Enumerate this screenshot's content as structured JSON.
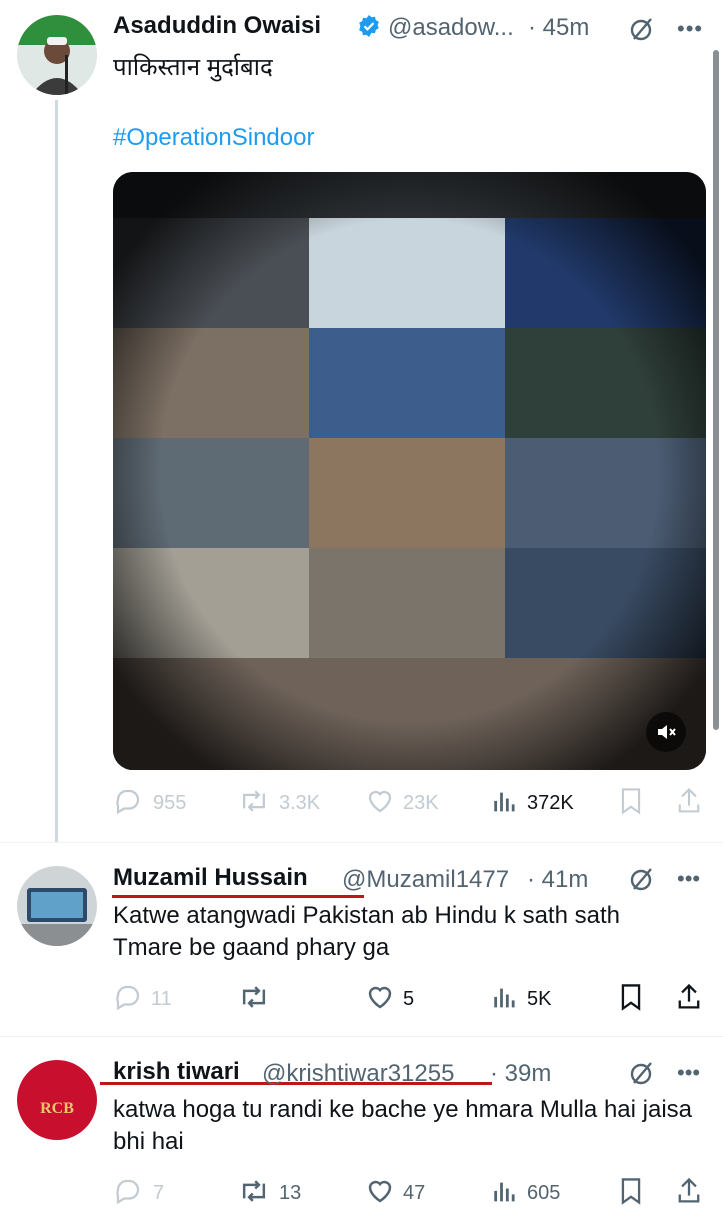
{
  "tweet1": {
    "name": "Asaduddin Owaisi",
    "handle": "@asadow...",
    "time": "· 45m",
    "text": "पाकिस्तान मुर्दाबाद",
    "hashtag": "#OperationSindoor",
    "actions": {
      "replies": "955",
      "reposts": "3.3K",
      "likes": "23K",
      "views": "372K"
    }
  },
  "reply1": {
    "name": "Muzamil Hussain",
    "handle": "@Muzamil1477",
    "time": "· 41m",
    "text": "Katwe atangwadi Pakistan ab Hindu k sath sath Tmare be gaand phary ga",
    "actions": {
      "replies": "11",
      "reposts": "",
      "likes": "5",
      "views": "5K"
    }
  },
  "reply2": {
    "name": "krish tiwari",
    "handle": "@krishtiwar31255",
    "time": "· 39m",
    "text": "katwa hoga tu randi ke bache ye hmara Mulla hai jaisa bhi hai",
    "avatar_text": "RCB",
    "actions": {
      "replies": "7",
      "reposts": "13",
      "likes": "47",
      "views": "605"
    }
  },
  "colors": {
    "accent": "#1d9bf0",
    "underline": "#c0151b",
    "rcb": "#c8102e"
  }
}
